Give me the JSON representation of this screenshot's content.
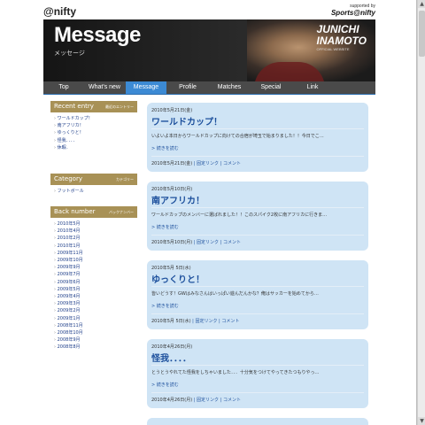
{
  "header": {
    "logo": "@nifty",
    "sponsor_line1": "supported by",
    "sponsor_line2": "Sports@nifty",
    "title": "Message",
    "subtitle": "メッセージ",
    "name_line1": "JUNICHI",
    "name_line2": "INAMOTO",
    "name_line3": "OFFICIAL WEBSITE"
  },
  "nav": {
    "items": [
      {
        "label": "Top",
        "active": false
      },
      {
        "label": "What's new",
        "active": false
      },
      {
        "label": "Message",
        "active": true
      },
      {
        "label": "Profile",
        "active": false
      },
      {
        "label": "Matches",
        "active": false
      },
      {
        "label": "Special",
        "active": false
      },
      {
        "label": "Link",
        "active": false
      }
    ]
  },
  "sidebar": {
    "recent": {
      "title": "Recent entry",
      "title_jp": "最近のエントリー",
      "items": [
        "ワールドカップ！",
        "南アフリカ！",
        "ゆっくりと！",
        "怪我．．．．",
        "休暇．"
      ]
    },
    "category": {
      "title": "Category",
      "title_jp": "カテゴリー",
      "items": [
        "フットボール"
      ]
    },
    "backnumber": {
      "title": "Back number",
      "title_jp": "バックナンバー",
      "items": [
        "2010年5月",
        "2010年4月",
        "2010年2月",
        "2010年1月",
        "2009年11月",
        "2009年10月",
        "2009年9月",
        "2009年7月",
        "2009年6月",
        "2009年5月",
        "2009年4月",
        "2009年3月",
        "2009年2月",
        "2009年1月",
        "2008年11月",
        "2008年10月",
        "2008年9月",
        "2008年8月"
      ]
    }
  },
  "entries": [
    {
      "date": "2010年5月21日(金)",
      "title": "ワールドカップ！",
      "text": "いよいよ本日からワールドカップに向けての合宿が埼玉で始まりました！！今日でこ…",
      "more": "> 続きを読む",
      "foot_date": "2010年5月21日(金)",
      "foot_link1": "固定リンク",
      "foot_link2": "コメント"
    },
    {
      "date": "2010年5月10日(月)",
      "title": "南アフリカ！",
      "text": "ワールドカップのメンバーに選ばれました！！このスパイク2枚に南アフリカに行きま…",
      "more": "> 続きを読む",
      "foot_date": "2010年5月10日(月)",
      "foot_link1": "固定リンク",
      "foot_link2": "コメント"
    },
    {
      "date": "2010年5月 5日(水)",
      "title": "ゆっくりと！",
      "text": "皆いどうす！GWはみなさんはいっぱい遊んだんかな？俺はサッカーを始めてから…",
      "more": "> 続きを読む",
      "foot_date": "2010年5月 5日(水)",
      "foot_link1": "固定リンク",
      "foot_link2": "コメント"
    },
    {
      "date": "2010年4月26日(月)",
      "title": "怪我．．．．",
      "text": "とうとうやれてた怪我をしちゃいました．．．十分気をつけてやってきたつもりやっ…",
      "more": "> 続きを読む",
      "foot_date": "2010年4月26日(月)",
      "foot_link1": "固定リンク",
      "foot_link2": "コメント"
    }
  ]
}
